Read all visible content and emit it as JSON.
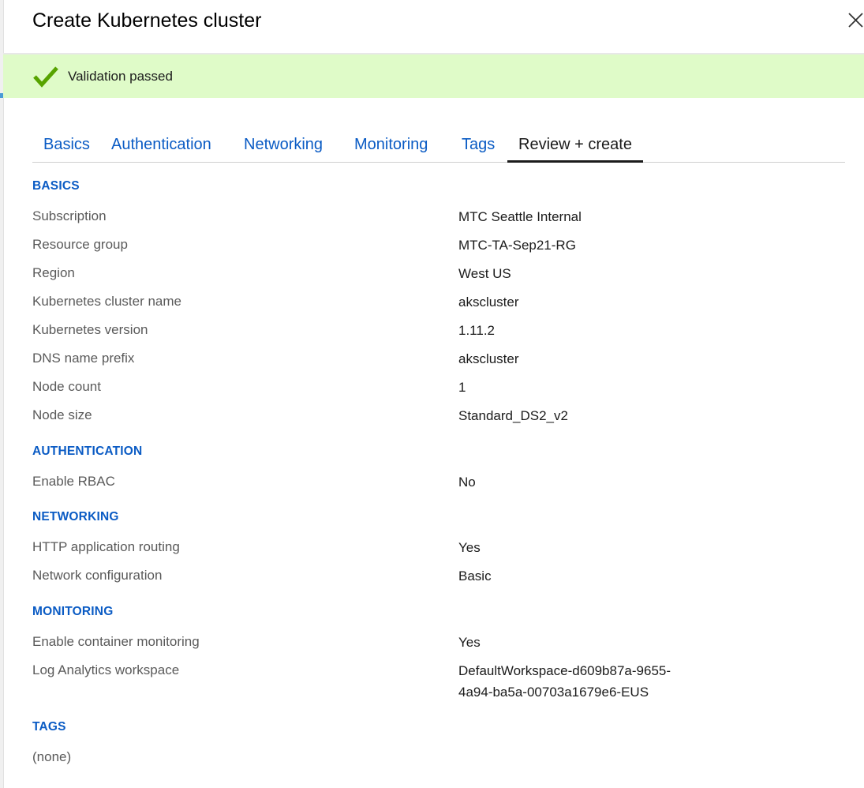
{
  "header": {
    "title": "Create Kubernetes cluster"
  },
  "validation": {
    "message": "Validation passed",
    "status_color": "#57a300"
  },
  "tabs": [
    {
      "label": "Basics"
    },
    {
      "label": "Authentication"
    },
    {
      "label": "Networking"
    },
    {
      "label": "Monitoring"
    },
    {
      "label": "Tags"
    },
    {
      "label": "Review + create",
      "active": true
    }
  ],
  "sections": {
    "basics": {
      "heading": "BASICS",
      "rows": [
        {
          "label": "Subscription",
          "value": "MTC Seattle Internal"
        },
        {
          "label": "Resource group",
          "value": "MTC-TA-Sep21-RG"
        },
        {
          "label": "Region",
          "value": "West US"
        },
        {
          "label": "Kubernetes cluster name",
          "value": "akscluster"
        },
        {
          "label": "Kubernetes version",
          "value": "1.11.2"
        },
        {
          "label": "DNS name prefix",
          "value": "akscluster"
        },
        {
          "label": "Node count",
          "value": "1"
        },
        {
          "label": "Node size",
          "value": "Standard_DS2_v2"
        }
      ]
    },
    "authentication": {
      "heading": "AUTHENTICATION",
      "rows": [
        {
          "label": "Enable RBAC",
          "value": "No"
        }
      ]
    },
    "networking": {
      "heading": "NETWORKING",
      "rows": [
        {
          "label": "HTTP application routing",
          "value": "Yes"
        },
        {
          "label": "Network configuration",
          "value": "Basic"
        }
      ]
    },
    "monitoring": {
      "heading": "MONITORING",
      "rows": [
        {
          "label": "Enable container monitoring",
          "value": "Yes"
        },
        {
          "label": "Log Analytics workspace",
          "value": "DefaultWorkspace-d609b87a-9655-\n4a94-ba5a-00703a1679e6-EUS"
        }
      ]
    },
    "tags": {
      "heading": "TAGS",
      "empty_text": "(none)"
    }
  },
  "icons": {
    "close": "close-icon",
    "check": "checkmark-icon"
  },
  "colors": {
    "accent": "#0a5bc4",
    "banner": "#dffbc8"
  }
}
